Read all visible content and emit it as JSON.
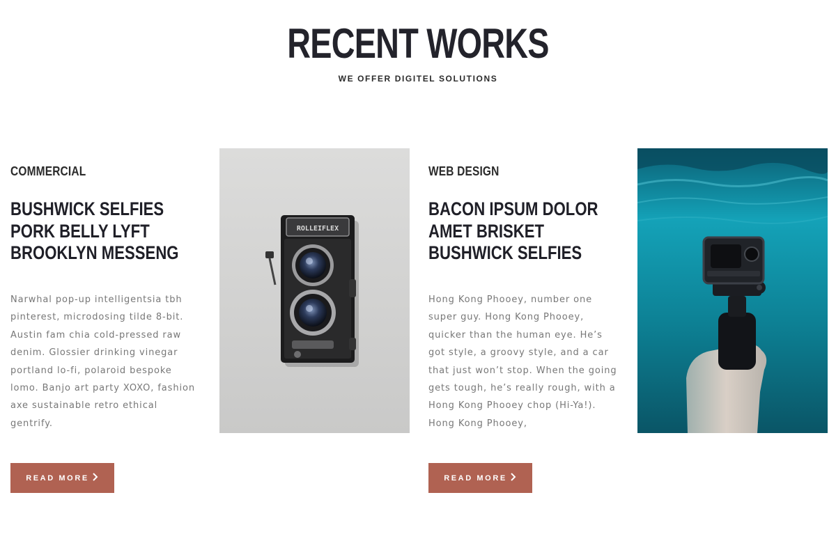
{
  "header": {
    "title": "RECENT WORKS",
    "subtitle": "WE OFFER DIGITEL SOLUTIONS"
  },
  "works": [
    {
      "category": "COMMERCIAL",
      "title_lines": [
        "BUSHWICK SELFIES",
        "PORK BELLY LYFT",
        "BROOKLYN MESSENG"
      ],
      "description_lines": [
        "Narwhal pop-up intelligentsia tbh",
        "pinterest, microdosing tilde 8-bit.",
        "Austin fam chia cold-pressed raw",
        "denim. Glossier drinking vinegar",
        "portland lo-fi, polaroid bespoke",
        "lomo. Banjo art party XOXO, fashion",
        "axe sustainable retro ethical",
        "gentrify."
      ],
      "button_label": "READ MORE",
      "camera_brand": "ROLLEIFLEX",
      "image_icon": "camera-icon"
    },
    {
      "category": "WEB DESIGN",
      "title_lines": [
        "BACON IPSUM DOLOR",
        "AMET BRISKET",
        "BUSHWICK SELFIES"
      ],
      "description_lines": [
        "Hong Kong Phooey, number one",
        "super guy. Hong Kong Phooey,",
        "quicker than the human eye. He’s",
        "got style, a groovy style, and a car",
        "that just won’t stop. When the going",
        "gets tough, he’s really rough, with a",
        "Hong Kong Phooey chop (Hi-Ya!).",
        "Hong Kong Phooey,"
      ],
      "button_label": "READ MORE",
      "image_icon": "action-camera-icon"
    }
  ],
  "icons": {
    "button_chevron": "chevron-right-icon"
  },
  "colors": {
    "accent": "#b06252",
    "heading": "#23232b",
    "body_text": "#777777",
    "camera_bg": "#d6d6d5",
    "water": "#0f8ea3"
  }
}
